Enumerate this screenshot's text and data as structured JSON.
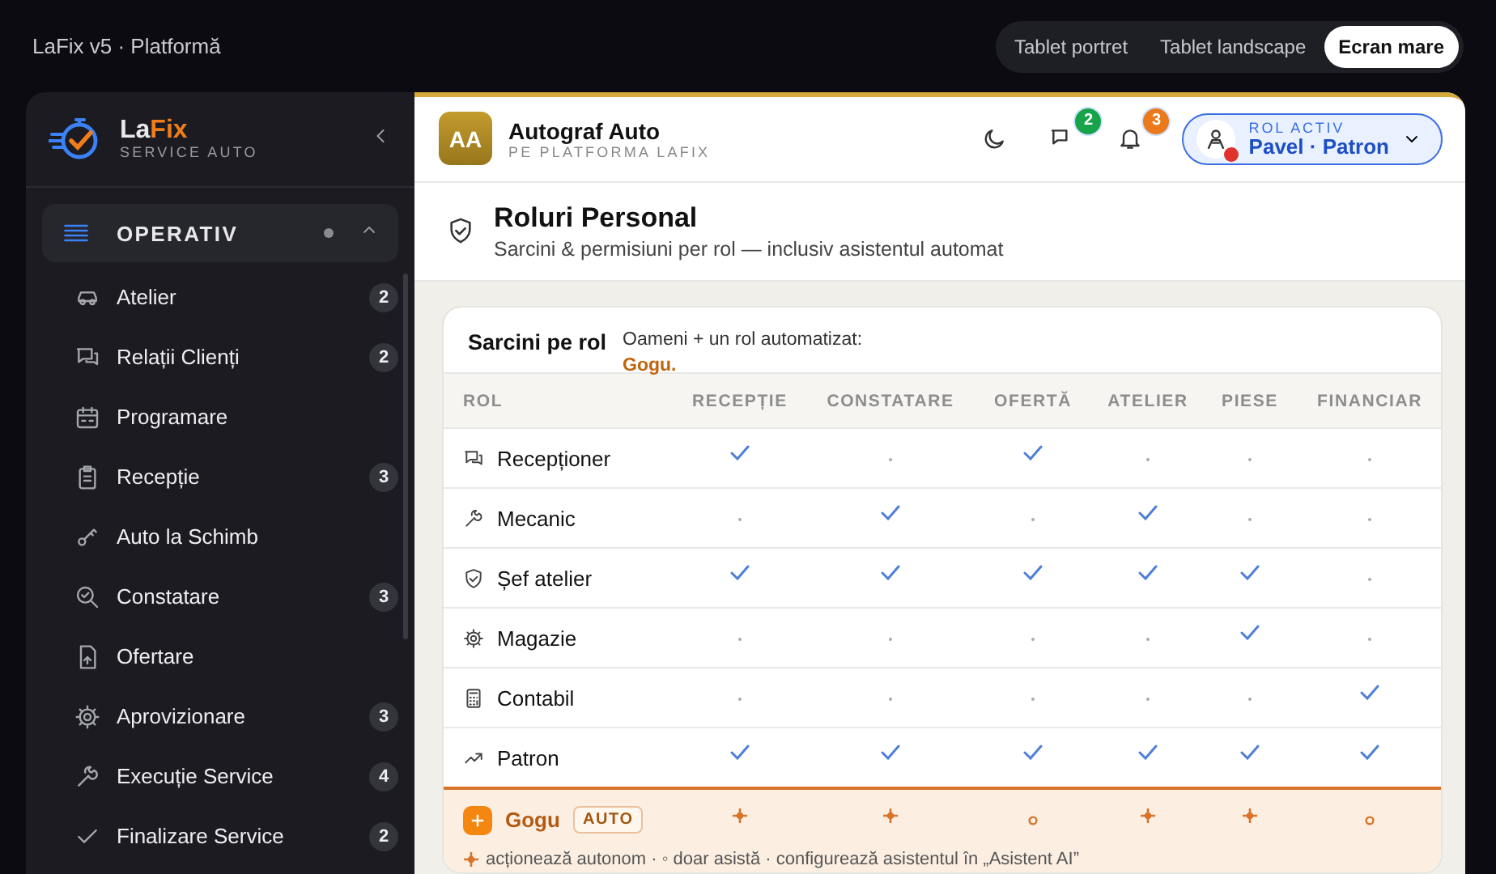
{
  "top_bar": {
    "title": "LaFix v5 · Platformă",
    "view_modes": [
      {
        "label": "Tablet portret",
        "selected": false
      },
      {
        "label": "Tablet landscape",
        "selected": false
      },
      {
        "label": "Ecran mare",
        "selected": true
      }
    ]
  },
  "sidebar": {
    "logo": {
      "name_start": "La",
      "name_end": "Fix",
      "subtitle": "SERVICE AUTO"
    },
    "section": {
      "label": "OPERATIV",
      "expanded": true,
      "items": [
        {
          "label": "Atelier",
          "badge": "2"
        },
        {
          "label": "Relații Clienți",
          "badge": "2"
        },
        {
          "label": "Programare"
        },
        {
          "label": "Recepție",
          "badge": "3"
        },
        {
          "label": "Auto la Schimb"
        },
        {
          "label": "Constatare",
          "badge": "3"
        },
        {
          "label": "Ofertare"
        },
        {
          "label": "Aprovizionare",
          "badge": "3"
        },
        {
          "label": "Execuție Service",
          "badge": "4"
        },
        {
          "label": "Finalizare Service",
          "badge": "2"
        }
      ]
    }
  },
  "header": {
    "avatar": "AA",
    "company": "Autograf Auto",
    "platform": "PE PLATFORMA LAFIX",
    "messages_badge": "2",
    "notifications_badge": "3",
    "role_label": "ROL ACTIV",
    "user": "Pavel · Patron"
  },
  "page": {
    "title": "Roluri Personal",
    "subtitle": "Sarcini & permisiuni per rol — inclusiv asistentul automat"
  },
  "card": {
    "title": "Sarcini pe rol",
    "note": "Oameni + un rol automatizat: **Gogu.**",
    "columns": [
      "ROL",
      "RECEPȚIE",
      "CONSTATARE",
      "OFERTĂ",
      "ATELIER",
      "PIESE",
      "FINANCIAR"
    ],
    "rows": [
      {
        "name": "Recepționer",
        "cells": [
          {
            "checked": true
          },
          {
            "checked": false
          },
          {
            "checked": true
          },
          {
            "checked": false
          },
          {
            "checked": false
          },
          {
            "checked": false
          }
        ]
      },
      {
        "name": "Mecanic",
        "cells": [
          {
            "checked": false
          },
          {
            "checked": true
          },
          {
            "checked": false
          },
          {
            "checked": true
          },
          {
            "checked": false
          },
          {
            "checked": false
          }
        ]
      },
      {
        "name": "Șef atelier",
        "cells": [
          {
            "checked": true
          },
          {
            "checked": true
          },
          {
            "checked": true
          },
          {
            "checked": true
          },
          {
            "checked": true
          },
          {
            "checked": false
          }
        ]
      },
      {
        "name": "Magazie",
        "cells": [
          {
            "checked": false
          },
          {
            "checked": false
          },
          {
            "checked": false
          },
          {
            "checked": false
          },
          {
            "checked": true
          },
          {
            "checked": false
          }
        ]
      },
      {
        "name": "Contabil",
        "cells": [
          {
            "checked": false
          },
          {
            "checked": false
          },
          {
            "checked": false
          },
          {
            "checked": false
          },
          {
            "checked": false
          },
          {
            "checked": true
          }
        ]
      },
      {
        "name": "Patron",
        "cells": [
          {
            "checked": true
          },
          {
            "checked": true
          },
          {
            "checked": true
          },
          {
            "checked": true
          },
          {
            "checked": true
          },
          {
            "checked": true
          }
        ]
      }
    ],
    "auto_row": {
      "name": "Gogu",
      "tag": "AUTO",
      "cells": [
        {
          "kind": "auto"
        },
        {
          "kind": "auto"
        },
        {
          "kind": "assist"
        },
        {
          "kind": "auto"
        },
        {
          "kind": "auto"
        },
        {
          "kind": "assist"
        }
      ]
    },
    "legend": "acționează autonom · ◦ doar asistă · configurează asistentul în „Asistent AI”"
  }
}
